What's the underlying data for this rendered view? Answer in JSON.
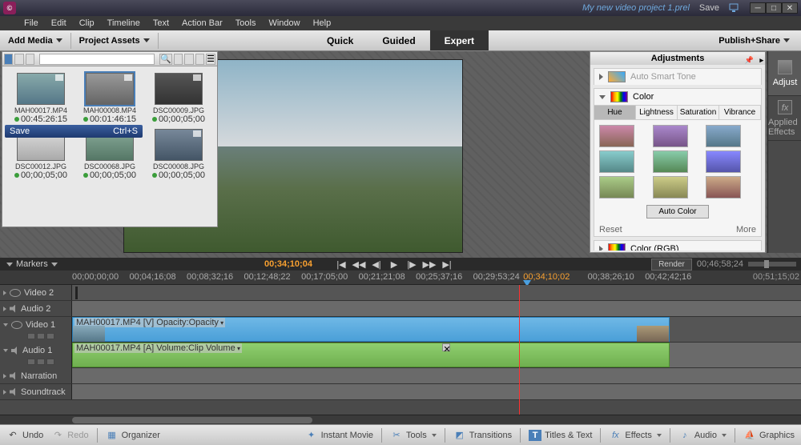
{
  "titlebar": {
    "project_name": "My new video project 1.prel",
    "save": "Save",
    "logo": "©"
  },
  "menu": [
    "File",
    "Edit",
    "Clip",
    "Timeline",
    "Text",
    "Action Bar",
    "Tools",
    "Window",
    "Help"
  ],
  "modebar": {
    "add_media": "Add Media",
    "project_assets": "Project Assets",
    "quick": "Quick",
    "guided": "Guided",
    "expert": "Expert",
    "publish": "Publish+Share"
  },
  "save_tooltip": {
    "label": "Save",
    "shortcut": "Ctrl+S"
  },
  "assets": [
    {
      "name": "MAH00017.MP4",
      "time": "00:45:26:15"
    },
    {
      "name": "MAH00008.MP4",
      "time": "00:01:46:15",
      "selected": true
    },
    {
      "name": "DSC00009.JPG",
      "time": "00;00;05;00"
    },
    {
      "name": "DSC00012.JPG",
      "time": "00;00;05;00"
    },
    {
      "name": "DSC00068.JPG",
      "time": "00;00;05;00"
    },
    {
      "name": "DSC00008.JPG",
      "time": "00;00;05;00"
    }
  ],
  "adjustments": {
    "title": "Adjustments",
    "smart_tone": "Auto Smart Tone",
    "color": "Color",
    "tabs": [
      "Hue",
      "Lightness",
      "Saturation",
      "Vibrance"
    ],
    "auto_color": "Auto Color",
    "reset": "Reset",
    "more": "More",
    "color_rgb": "Color (RGB)"
  },
  "right_toolbar": {
    "adjust": "Adjust",
    "applied_effects": "Applied Effects"
  },
  "playback": {
    "markers": "Markers",
    "timecode": "00;34;10;04",
    "render": "Render",
    "zoom_time": "00;46;58;24"
  },
  "ruler": {
    "ticks": [
      "00;00;00;00",
      "00;04;16;08",
      "00;08;32;16",
      "00;12;48;22",
      "00;17;05;00",
      "00;21;21;08",
      "00;25;37;16",
      "00;29;53;24",
      "00;34;10;02",
      "00;38;26;10",
      "00;42;42;16"
    ],
    "end": "00;51;15;02",
    "playhead": "00;34;10;02"
  },
  "tracks": {
    "video2": "Video 2",
    "audio2": "Audio 2",
    "video1": "Video 1",
    "audio1": "Audio 1",
    "narration": "Narration",
    "soundtrack": "Soundtrack"
  },
  "clips": {
    "video1_label": "MAH00017.MP4 [V] Opacity:Opacity",
    "audio1_label": "MAH00017.MP4 [A] Volume:Clip Volume"
  },
  "bottom": {
    "undo": "Undo",
    "redo": "Redo",
    "organizer": "Organizer",
    "instant_movie": "Instant Movie",
    "tools": "Tools",
    "transitions": "Transitions",
    "titles": "Titles & Text",
    "effects": "Effects",
    "audio": "Audio",
    "graphics": "Graphics"
  }
}
